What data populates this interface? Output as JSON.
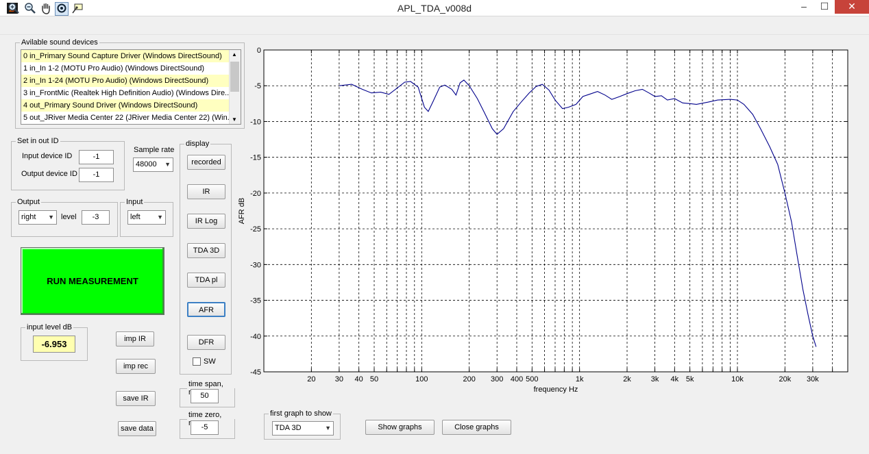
{
  "window": {
    "title": "APL_TDA_v008d",
    "controls": [
      "–",
      "☐",
      "✕"
    ]
  },
  "toolbar": {
    "icons": [
      "zoom-in-icon",
      "zoom-out-icon",
      "pan-hand-icon",
      "rotate-icon",
      "data-cursor-icon"
    ]
  },
  "devices": {
    "title": "Avilable sound devices",
    "items": [
      "0 in_Primary Sound Capture Driver (Windows DirectSound)",
      "1 in_In 1-2 (MOTU Pro Audio) (Windows DirectSound)",
      "2 in_In 1-24 (MOTU Pro Audio) (Windows DirectSound)",
      "3 in_FrontMic (Realtek High Definition Audio) (Windows Dire...",
      "4 out_Primary Sound Driver (Windows DirectSound)",
      "5 out_JRiver Media Center 22 (JRiver Media Center 22) (Win..."
    ],
    "highlighted": [
      0,
      2,
      4
    ]
  },
  "io": {
    "title": "Set in out ID",
    "input_label": "Input device ID",
    "input_value": "-1",
    "output_label": "Output device ID",
    "output_value": "-1"
  },
  "sample_rate": {
    "label": "Sample rate",
    "value": "48000"
  },
  "output": {
    "title": "Output",
    "channel": "right",
    "level_label": "level",
    "level_value": "-3"
  },
  "input": {
    "title": "Input",
    "channel": "left"
  },
  "run": {
    "label": "RUN MEASUREMENT"
  },
  "input_level": {
    "title": "input level dB",
    "value": "-6.953"
  },
  "actions": {
    "imp_ir": "imp IR",
    "imp_rec": "imp rec",
    "save_ir": "save IR",
    "save_data": "save data"
  },
  "display": {
    "title": "display",
    "buttons": [
      "recorded",
      "IR",
      "IR Log",
      "TDA 3D",
      "TDA pl",
      "AFR",
      "DFR"
    ],
    "active": "AFR",
    "sw_label": "SW",
    "sw_checked": false
  },
  "time_span": {
    "label": "time span, ms",
    "value": "50"
  },
  "time_zero": {
    "label": "time zero, ms",
    "value": "-5"
  },
  "first_graph": {
    "label": "first graph to show",
    "value": "TDA 3D"
  },
  "graph_buttons": {
    "show": "Show graphs",
    "close": "Close graphs"
  },
  "colors": {
    "run_button": "#00ff00",
    "curve": "#00008b",
    "input_level_bg": "#ffffb0",
    "list_highlight": "#ffffc0"
  },
  "chart_data": {
    "type": "line",
    "xlabel": "frequency   Hz",
    "ylabel": "AFR dB",
    "x_scale": "log",
    "xlim": [
      10,
      50000
    ],
    "ylim": [
      -45,
      0
    ],
    "grid": true,
    "yticks": [
      0,
      -5,
      -10,
      -15,
      -20,
      -25,
      -30,
      -35,
      -40,
      -45
    ],
    "xticks": [
      {
        "v": 20,
        "l": "20"
      },
      {
        "v": 30,
        "l": "30"
      },
      {
        "v": 40,
        "l": "40"
      },
      {
        "v": 50,
        "l": "50"
      },
      {
        "v": 100,
        "l": "100"
      },
      {
        "v": 200,
        "l": "200"
      },
      {
        "v": 300,
        "l": "300"
      },
      {
        "v": 400,
        "l": "400"
      },
      {
        "v": 500,
        "l": "500"
      },
      {
        "v": 1000,
        "l": "1k"
      },
      {
        "v": 2000,
        "l": "2k"
      },
      {
        "v": 3000,
        "l": "3k"
      },
      {
        "v": 4000,
        "l": "4k"
      },
      {
        "v": 5000,
        "l": "5k"
      },
      {
        "v": 10000,
        "l": "10k"
      },
      {
        "v": 20000,
        "l": "20k"
      },
      {
        "v": 30000,
        "l": "30k"
      }
    ],
    "series": [
      {
        "points": [
          [
            30,
            -5.0
          ],
          [
            36,
            -4.8
          ],
          [
            42,
            -5.5
          ],
          [
            48,
            -6.0
          ],
          [
            55,
            -5.9
          ],
          [
            62,
            -6.2
          ],
          [
            70,
            -5.3
          ],
          [
            78,
            -4.5
          ],
          [
            85,
            -4.4
          ],
          [
            95,
            -5.2
          ],
          [
            104,
            -8.0
          ],
          [
            110,
            -8.6
          ],
          [
            118,
            -7.2
          ],
          [
            130,
            -5.2
          ],
          [
            140,
            -4.9
          ],
          [
            155,
            -5.5
          ],
          [
            165,
            -6.3
          ],
          [
            175,
            -4.6
          ],
          [
            185,
            -4.2
          ],
          [
            200,
            -5.0
          ],
          [
            225,
            -6.8
          ],
          [
            250,
            -8.8
          ],
          [
            280,
            -11.0
          ],
          [
            300,
            -11.8
          ],
          [
            330,
            -11.0
          ],
          [
            380,
            -8.6
          ],
          [
            430,
            -7.2
          ],
          [
            480,
            -6.0
          ],
          [
            530,
            -5.1
          ],
          [
            580,
            -4.8
          ],
          [
            640,
            -5.6
          ],
          [
            700,
            -7.0
          ],
          [
            780,
            -8.2
          ],
          [
            850,
            -8.0
          ],
          [
            950,
            -7.6
          ],
          [
            1050,
            -6.5
          ],
          [
            1150,
            -6.2
          ],
          [
            1300,
            -5.8
          ],
          [
            1450,
            -6.3
          ],
          [
            1600,
            -6.9
          ],
          [
            1800,
            -6.5
          ],
          [
            2000,
            -6.1
          ],
          [
            2250,
            -5.7
          ],
          [
            2500,
            -5.5
          ],
          [
            2750,
            -6.0
          ],
          [
            3000,
            -6.5
          ],
          [
            3300,
            -6.4
          ],
          [
            3600,
            -7.0
          ],
          [
            4000,
            -6.8
          ],
          [
            4500,
            -7.4
          ],
          [
            5000,
            -7.5
          ],
          [
            5500,
            -7.6
          ],
          [
            6500,
            -7.3
          ],
          [
            7500,
            -7.0
          ],
          [
            9000,
            -6.9
          ],
          [
            10000,
            -7.0
          ],
          [
            11000,
            -7.6
          ],
          [
            12500,
            -9.0
          ],
          [
            14000,
            -11.0
          ],
          [
            16000,
            -13.5
          ],
          [
            18000,
            -16.0
          ],
          [
            20000,
            -20.0
          ],
          [
            22000,
            -24.0
          ],
          [
            24000,
            -29.0
          ],
          [
            26000,
            -33.5
          ],
          [
            28000,
            -37.0
          ],
          [
            30000,
            -40.0
          ],
          [
            31500,
            -41.5
          ]
        ]
      }
    ]
  }
}
